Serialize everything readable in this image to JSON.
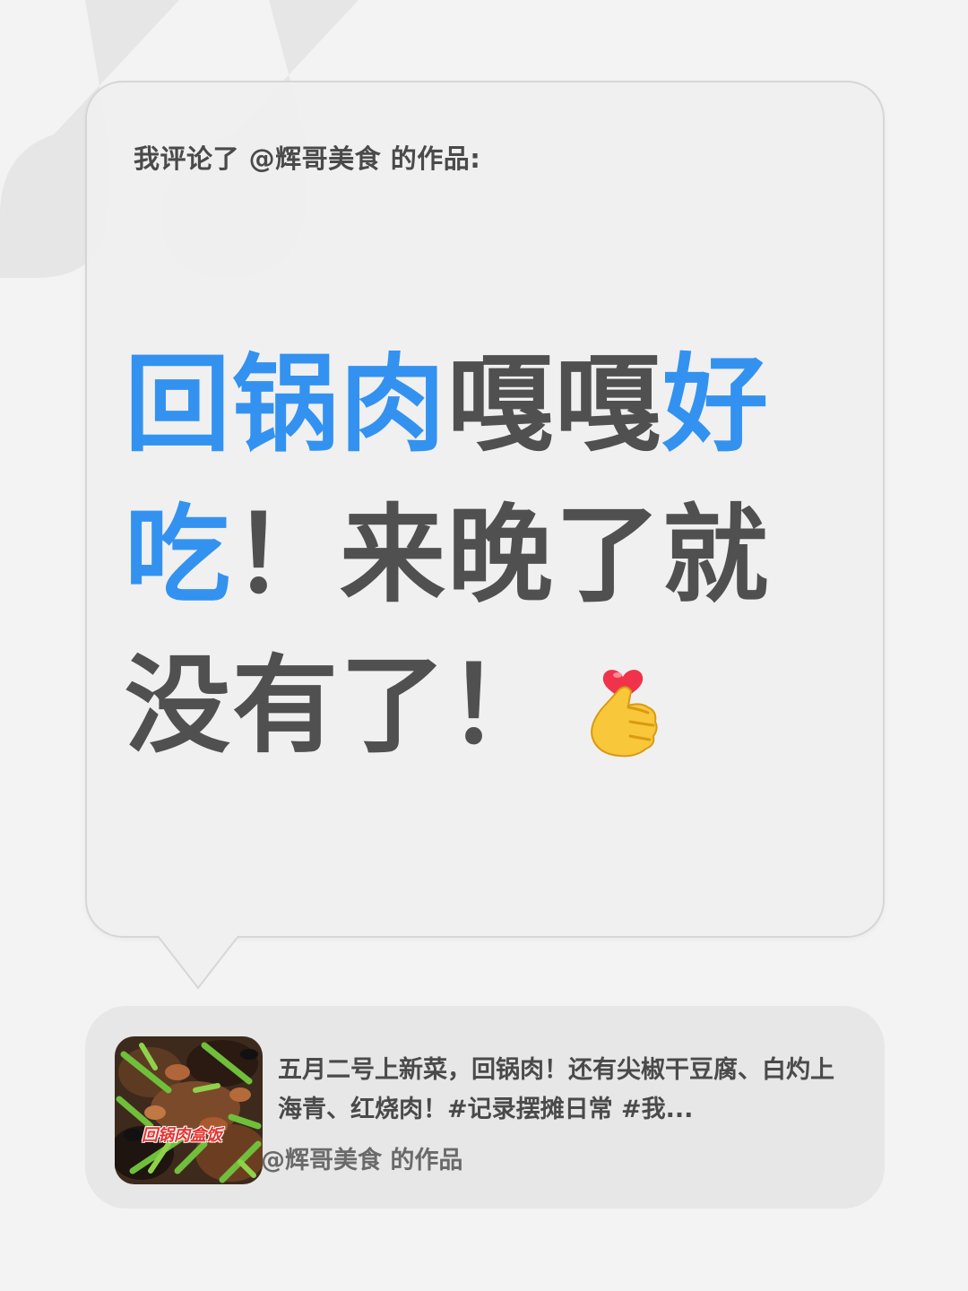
{
  "comment": {
    "header": "我评论了 @辉哥美食 的作品:",
    "segments": [
      {
        "text": "回锅肉",
        "color": "#3392f0"
      },
      {
        "text": "嘎嘎",
        "color": "#505050"
      },
      {
        "text": "好吃",
        "color": "#3392f0"
      },
      {
        "text": "！来晚了就没有了！",
        "color": "#505050"
      }
    ],
    "emoji": "heart-hand-icon"
  },
  "post": {
    "thumbnail_caption": "回锅肉盒饭",
    "description": "五月二号上新菜，回锅肉！还有尖椒干豆腐、白灼上海青、红烧肉！#记录摆摊日常 #我...",
    "author": "@辉哥美食 的作品"
  },
  "colors": {
    "accent": "#3392f0",
    "text": "#505050",
    "background": "#f3f3f3",
    "card": "#f0f0f0",
    "post_card": "#e7e7e7"
  }
}
